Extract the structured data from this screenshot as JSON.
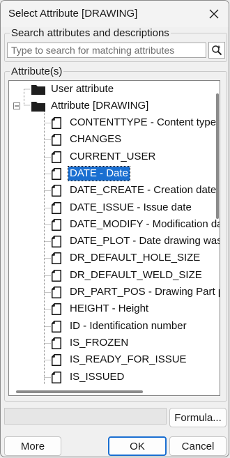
{
  "window": {
    "title": "Select Attribute [DRAWING]",
    "close_icon": "close-icon"
  },
  "search": {
    "label": "Search attributes and descriptions",
    "value": "",
    "placeholder": "Type to search for matching attributes",
    "button_icon": "magnifier-plus-icon"
  },
  "attributes": {
    "label": "Attribute(s)",
    "root_nodes": [
      {
        "label": "User attribute",
        "icon": "folder-icon",
        "expanded": false
      },
      {
        "label": "Attribute [DRAWING]",
        "icon": "folder-icon",
        "expanded": true
      }
    ],
    "items": [
      {
        "label": "CONTENTTYPE  -  Content type",
        "selected": false
      },
      {
        "label": "CHANGES",
        "selected": false
      },
      {
        "label": "CURRENT_USER",
        "selected": false
      },
      {
        "label": "DATE  -  Date",
        "selected": true
      },
      {
        "label": "DATE_CREATE  -  Creation date",
        "selected": false
      },
      {
        "label": "DATE_ISSUE  -  Issue date",
        "selected": false
      },
      {
        "label": "DATE_MODIFY  -  Modification date",
        "selected": false
      },
      {
        "label": "DATE_PLOT  -  Date drawing was plotted",
        "selected": false
      },
      {
        "label": "DR_DEFAULT_HOLE_SIZE",
        "selected": false
      },
      {
        "label": "DR_DEFAULT_WELD_SIZE",
        "selected": false
      },
      {
        "label": "DR_PART_POS  -  Drawing Part position",
        "selected": false
      },
      {
        "label": "HEIGHT  -  Height",
        "selected": false
      },
      {
        "label": "ID  -  Identification number",
        "selected": false
      },
      {
        "label": "IS_FROZEN",
        "selected": false
      },
      {
        "label": "IS_READY_FOR_ISSUE",
        "selected": false
      },
      {
        "label": "IS_ISSUED",
        "selected": false
      }
    ]
  },
  "buttons": {
    "formula": "Formula...",
    "more": "More",
    "ok": "OK",
    "cancel": "Cancel"
  },
  "colors": {
    "selection": "#1a6fd1",
    "ok_border": "#1a6fd1"
  }
}
